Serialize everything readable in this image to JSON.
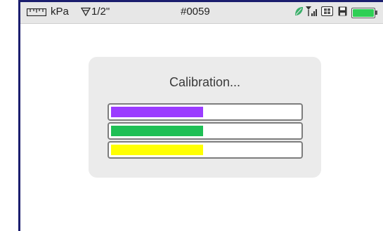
{
  "status_bar": {
    "ruler_icon": "ruler-icon",
    "unit": "kPa",
    "pipe_icon": "pipe-size-icon",
    "pipe_size": "1/2\"",
    "device_id": "#0059",
    "leaf_icon": "leaf-icon",
    "signal_icon": "signal-strength-icon",
    "sim_icon": "sim-card-icon",
    "save_icon": "save-icon",
    "battery_icon": "battery-icon",
    "battery_level": 1.0,
    "battery_color": "#2fcf55"
  },
  "dialog": {
    "title": "Calibration...",
    "bars": [
      {
        "name": "purple",
        "color": "#9b3cff",
        "progress": 0.5
      },
      {
        "name": "green",
        "color": "#1fbf55",
        "progress": 0.5
      },
      {
        "name": "yellow",
        "color": "#ffff00",
        "progress": 0.5
      }
    ]
  }
}
